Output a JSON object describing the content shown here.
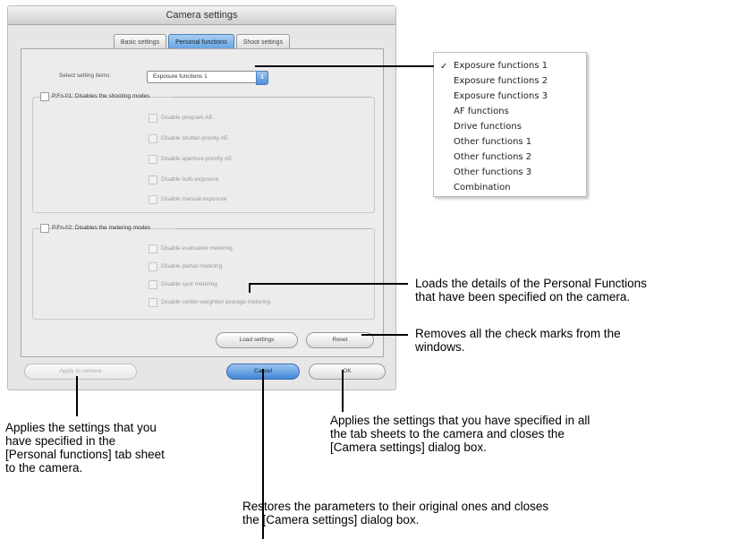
{
  "dialog": {
    "title": "Camera settings",
    "tabs": [
      "Basic settings",
      "Personal functions",
      "Shoot settings"
    ],
    "active_tab": "Personal functions",
    "select_label": "Select setting items:",
    "select_value": "Exposure functions 1",
    "groups": [
      {
        "header": "P.Fn-01: Disables the shooting modes",
        "options": [
          "Disable program AE",
          "Disable shutter-priority AE",
          "Disable aperture-priority AE",
          "Disable bulb exposure",
          "Disable manual exposure"
        ]
      },
      {
        "header": "P.Fn-02: Disables the metering modes",
        "options": [
          "Disable evaluative metering",
          "Disable partial metering",
          "Disable spot metering",
          "Disable center-weighted average metering"
        ]
      }
    ],
    "buttons": {
      "load": "Load settings",
      "reset": "Reset",
      "apply": "Apply to camera",
      "cancel": "Cancel",
      "ok": "OK"
    }
  },
  "menu": {
    "items": [
      "Exposure functions 1",
      "Exposure functions 2",
      "Exposure functions 3",
      "AF functions",
      "Drive functions",
      "Other functions 1",
      "Other functions 2",
      "Other functions 3",
      "Combination"
    ],
    "checked_index": 0,
    "check_glyph": "✓"
  },
  "callouts": {
    "load": "Loads the details of the Personal Functions\nthat have been specified on the camera.",
    "reset": "Removes all the check marks from the\nwindows.",
    "apply": "Applies the settings that you\nhave specified in the\n[Personal functions] tab sheet\nto the camera.",
    "ok": "Applies the settings that you have specified in all\nthe tab sheets to the camera and closes the\n[Camera settings] dialog box.",
    "cancel": "Restores the parameters to their original ones and closes\nthe [Camera settings] dialog box."
  }
}
